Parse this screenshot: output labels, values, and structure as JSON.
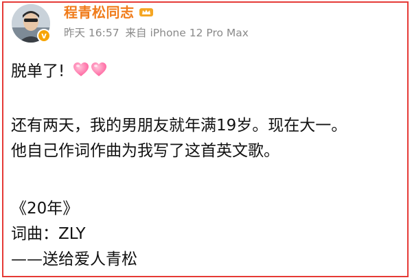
{
  "post": {
    "author": {
      "name": "程青松同志",
      "verified": true,
      "avatar_icon": "avatar-photo",
      "badge_icon": "verified-v-icon",
      "badge_text": "v",
      "name_color": "#f07b1a"
    },
    "meta": {
      "time": "昨天 16:57",
      "source": "来自 iPhone 12 Pro Max"
    },
    "lines": [
      "脱单了!",
      "还有两天，我的男朋友就年满19岁。现在大一。",
      "他自己作词作曲为我写了这首英文歌。",
      "《20年》",
      "词曲：ZLY",
      "——送给爱人青松"
    ],
    "emoji": [
      "heart-icon",
      "heart-icon"
    ]
  },
  "colors": {
    "frame": "#e53935",
    "meta_text": "#8a8a8a",
    "body_text": "#111111",
    "heart": "#ff6fa5"
  }
}
